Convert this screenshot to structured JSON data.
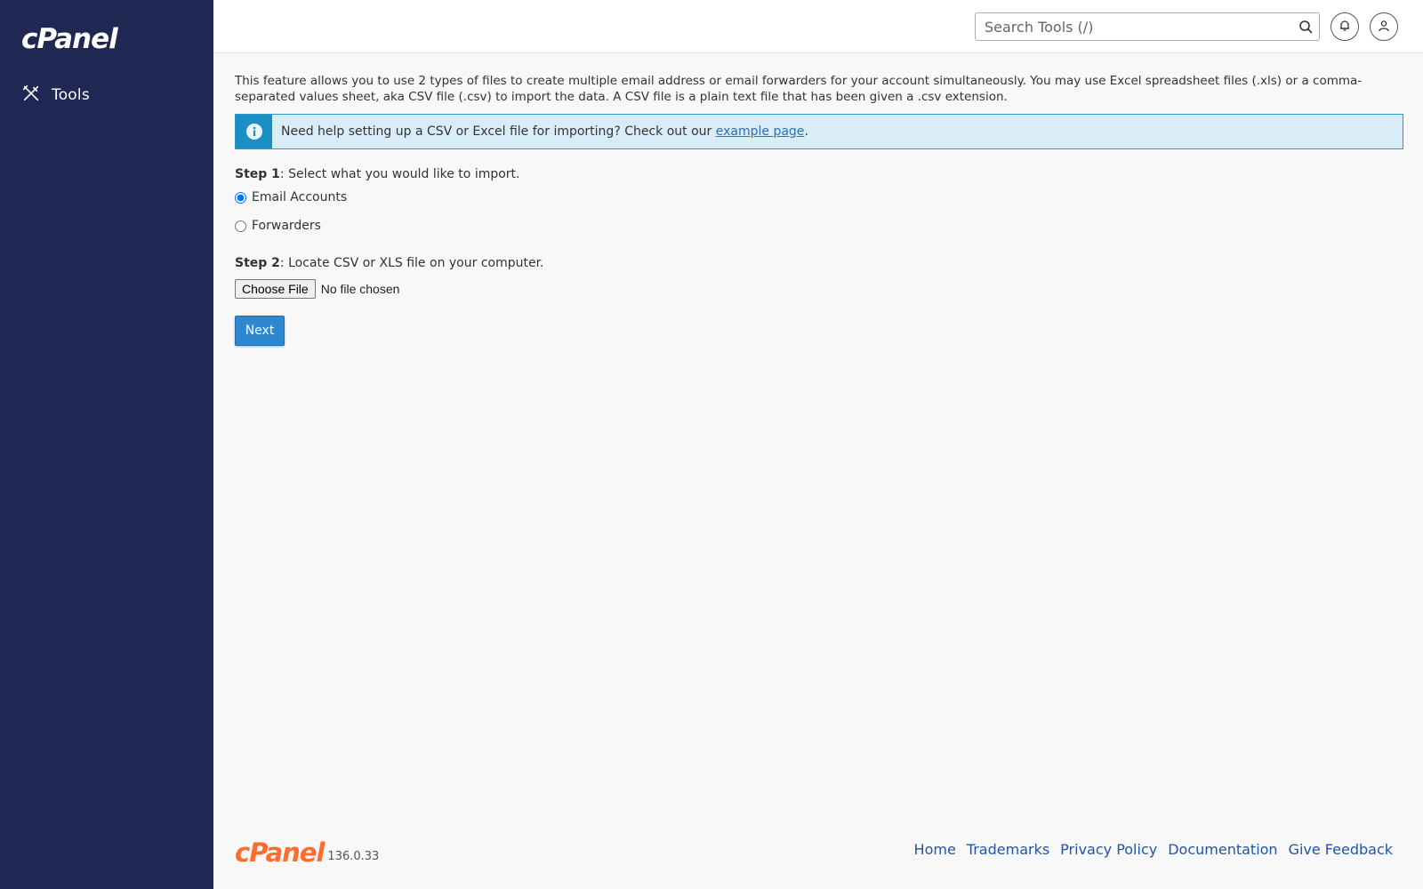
{
  "app": {
    "logo_text": "cPanel",
    "brand_color": "#1f2753",
    "accent_color": "#ff6c2c"
  },
  "sidebar": {
    "items": [
      {
        "label": "Tools",
        "icon": "tools-icon"
      }
    ]
  },
  "header": {
    "search": {
      "placeholder": "Search Tools (/)",
      "value": ""
    },
    "icons": [
      "search-icon",
      "bell-icon",
      "user-icon"
    ]
  },
  "main": {
    "intro": "This feature allows you to use 2 types of files to create multiple email address or email forwarders for your account simultaneously. You may use Excel spreadsheet files (.xls) or a comma-separated values sheet, aka CSV file (.csv) to import the data. A CSV file is a plain text file that has been given a .csv extension.",
    "alert": {
      "text": "Need help setting up a CSV or Excel file for importing? Check out our ",
      "link_text": "example page",
      "suffix": "."
    },
    "step1": {
      "label": "Step 1",
      "text": ": Select what you would like to import.",
      "options": [
        {
          "label": "Email Accounts",
          "checked": true
        },
        {
          "label": "Forwarders",
          "checked": false
        }
      ]
    },
    "step2": {
      "label": "Step 2",
      "text": ": Locate CSV or XLS file on your computer.",
      "choose_label": "Choose File",
      "file_status": "No file chosen"
    },
    "next_label": "Next"
  },
  "footer": {
    "logo_text": "cPanel",
    "version": "136.0.33",
    "links": [
      "Home",
      "Trademarks",
      "Privacy Policy",
      "Documentation",
      "Give Feedback"
    ]
  }
}
